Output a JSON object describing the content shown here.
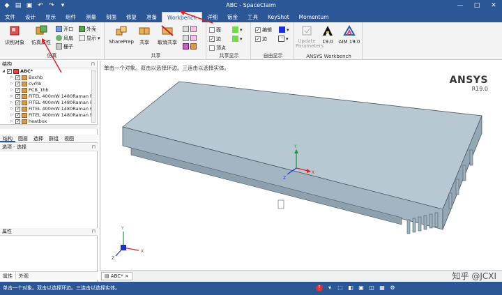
{
  "window": {
    "title": "ABC - SpaceClaim",
    "qat_icons": [
      "app-icon",
      "open-icon",
      "save-icon",
      "undo-icon",
      "redo-icon",
      "customize-icon"
    ],
    "controls": [
      "minimize-icon",
      "maximize-icon",
      "close-icon"
    ]
  },
  "menu_tabs": [
    {
      "label": "文件"
    },
    {
      "label": "设计"
    },
    {
      "label": "显示"
    },
    {
      "label": "组件"
    },
    {
      "label": "测量"
    },
    {
      "label": "刻面"
    },
    {
      "label": "修复"
    },
    {
      "label": "准备"
    },
    {
      "label": "Workbench",
      "active": true
    },
    {
      "label": "详细"
    },
    {
      "label": "钣金"
    },
    {
      "label": "工具"
    },
    {
      "label": "KeyShot"
    },
    {
      "label": "Momentum"
    }
  ],
  "ribbon": {
    "sim_group": {
      "label": "仿真",
      "identify_btn": "识别对象",
      "sim_btn": "仿真属性",
      "open_btn": "开口",
      "fan_btn": "风扇",
      "grid_btn": "栅子",
      "shell_btn": "外壳",
      "display_btn": "显示"
    },
    "share_group": {
      "label": "共享",
      "shareprep_btn": "SharePrep",
      "share_btn": "共享",
      "unshare_btn": "取消共享"
    },
    "share_display_group": {
      "label": "共享显示",
      "face_label": "面",
      "edge_label": "边",
      "vertex_label": "顶点"
    },
    "free_display_group": {
      "label": "自由显示",
      "edit_label": "编辑",
      "edge_label": "边"
    },
    "ansys_group": {
      "label": "ANSYS Workbench",
      "update_btn": "Update Parameters",
      "v190_btn": "19.0",
      "aim_btn": "AIM 19.0"
    }
  },
  "structure_panel": {
    "title": "结构",
    "root": "ABC*",
    "items": [
      {
        "label": "Boxhb"
      },
      {
        "label": "cvrhb"
      },
      {
        "label": "PCB_1hb"
      },
      {
        "label": "FITEL 400mW 1480Raman P"
      },
      {
        "label": "FITEL 400mW 1480Raman P"
      },
      {
        "label": "FITEL 400mW 1480Raman P"
      },
      {
        "label": "FITEL 400mW 1480Raman P"
      },
      {
        "label": "heatbox"
      }
    ],
    "tabs": [
      {
        "label": "结构",
        "active": true
      },
      {
        "label": "图层"
      },
      {
        "label": "选择"
      },
      {
        "label": "群组"
      },
      {
        "label": "视图"
      }
    ]
  },
  "options_panel": {
    "title": "选项 - 选择"
  },
  "properties_panel": {
    "title": "属性"
  },
  "bottom_tabs": [
    {
      "label": "属性",
      "active": true
    },
    {
      "label": "外观"
    }
  ],
  "viewport": {
    "hint": "单击一个对象。双击以选择环边。三连击以选择实体。",
    "brand": "ANSYS",
    "version": "R19.0"
  },
  "doc_tab": {
    "label": "ABC*"
  },
  "watermark": "知乎 @JCXI",
  "status": {
    "text": "单击一个对象。双击以选择环边。三连击以选择实体。"
  },
  "colors": {
    "titlebar": "#2b5797",
    "ribbon_bg": "#f3f3f3",
    "model_face": "#b3c4cf",
    "annotation_red": "#e0202a"
  }
}
